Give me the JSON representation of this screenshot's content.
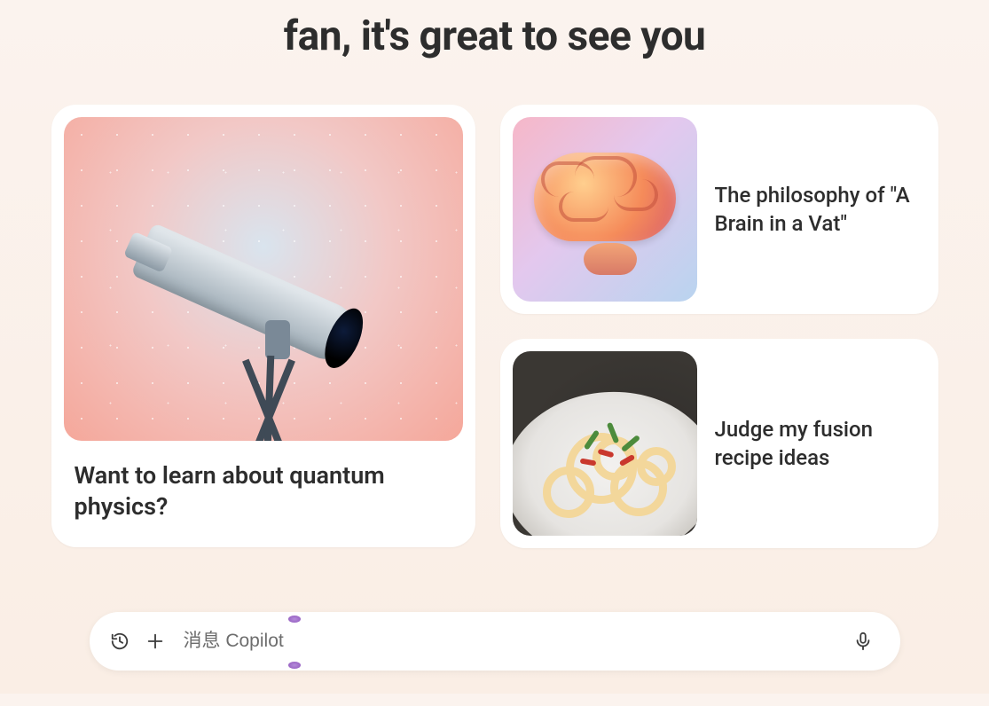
{
  "greeting": "fan, it's great to see you",
  "cards": {
    "large": {
      "title": "Want to learn about quantum physics?",
      "image_name": "telescope-illustration"
    },
    "small": [
      {
        "title": "The philosophy of \"A Brain in a Vat\"",
        "image_name": "brain-illustration"
      },
      {
        "title": "Judge my fusion recipe ideas",
        "image_name": "pasta-photo"
      }
    ]
  },
  "input": {
    "placeholder": "消息 Copilot",
    "history_icon": "history-icon",
    "add_icon": "plus-icon",
    "mic_icon": "microphone-icon"
  }
}
